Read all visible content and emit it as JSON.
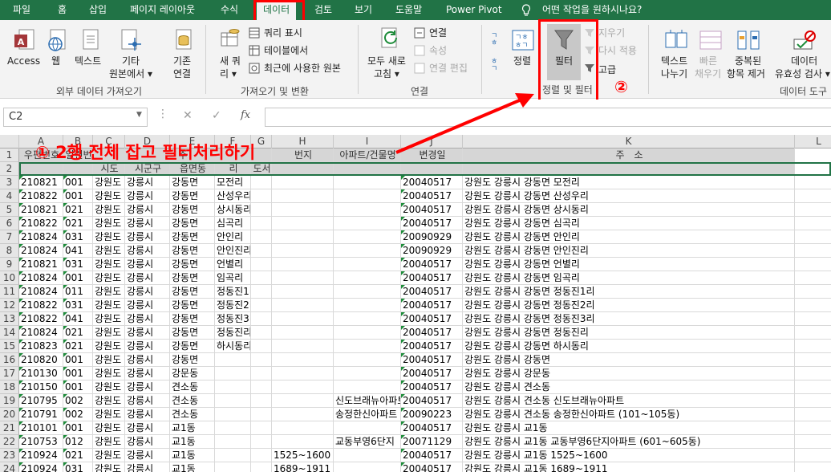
{
  "tabs": [
    "파일",
    "홈",
    "삽입",
    "페이지 레이아웃",
    "수식",
    "데이터",
    "검토",
    "보기",
    "도움말",
    "Power Pivot",
    "어떤 작업을 원하시나요?"
  ],
  "ribbon": {
    "external": {
      "access": "Access",
      "web": "웹",
      "text": "텍스트",
      "other_1": "기타",
      "other_2": "원본에서 ▾",
      "group": "외부 데이터 가져오기"
    },
    "get": {
      "existing_1": "기존",
      "existing_2": "연결",
      "newq_1": "새 쿼",
      "newq_2": "리 ▾",
      "show_query": "쿼리 표시",
      "from_table": "테이블에서",
      "recent": "최근에 사용한 원본",
      "group": "가져오기 및 변환"
    },
    "conn": {
      "refresh_1": "모두 새로",
      "refresh_2": "고침 ▾",
      "connections": "연결",
      "properties": "속성",
      "edit_links": "연결 편집",
      "group": "연결"
    },
    "sort": {
      "sort": "정렬",
      "filter": "필터",
      "clear": "지우기",
      "reapply": "다시 적용",
      "advanced": "고급",
      "group": "정렬 및 필터"
    },
    "tools": {
      "text_cols_1": "텍스트",
      "text_cols_2": "나누기",
      "flash_1": "빠른",
      "flash_2": "채우기",
      "remove_dup_1": "중복된",
      "remove_dup_2": "항목 제거",
      "validate_1": "데이터",
      "validate_2": "유효성 검사 ▾",
      "group": "데이터 도구"
    }
  },
  "formula": {
    "name_box": "C2",
    "cancel": "✕",
    "enter": "✓",
    "fx": "fx",
    "value": ""
  },
  "columns": [
    "A",
    "B",
    "C",
    "D",
    "E",
    "F",
    "G",
    "H",
    "I",
    "J",
    "K",
    "L"
  ],
  "row_numbers": [
    "1",
    "2",
    "3",
    "4",
    "5",
    "6",
    "7",
    "8",
    "9",
    "10",
    "11",
    "12",
    "13",
    "14",
    "15",
    "16",
    "17",
    "18",
    "19",
    "20",
    "21",
    "22",
    "23",
    "24"
  ],
  "header_row1": {
    "a": "우편번호",
    "b": "일련번",
    "d": "주",
    "h": "번지",
    "i": "아파트/건물명",
    "j": "변경일",
    "k": "주　소"
  },
  "header_row2": {
    "c": "시도",
    "d": "시군구",
    "e": "읍면동",
    "f": "리",
    "g": "도서"
  },
  "rows": [
    [
      "210821",
      "001",
      "강원도",
      "강릉시",
      "강동면",
      "모전리",
      "",
      "",
      "",
      "20040517",
      "강원도 강릉시 강동면 모전리"
    ],
    [
      "210822",
      "001",
      "강원도",
      "강릉시",
      "강동면",
      "산성우리",
      "",
      "",
      "",
      "20040517",
      "강원도 강릉시 강동면 산성우리"
    ],
    [
      "210821",
      "021",
      "강원도",
      "강릉시",
      "강동면",
      "상시동리",
      "",
      "",
      "",
      "20040517",
      "강원도 강릉시 강동면 상시동리"
    ],
    [
      "210822",
      "021",
      "강원도",
      "강릉시",
      "강동면",
      "심곡리",
      "",
      "",
      "",
      "20040517",
      "강원도 강릉시 강동면 심곡리"
    ],
    [
      "210824",
      "031",
      "강원도",
      "강릉시",
      "강동면",
      "안인리",
      "",
      "",
      "",
      "20090929",
      "강원도 강릉시 강동면 안인리"
    ],
    [
      "210824",
      "041",
      "강원도",
      "강릉시",
      "강동면",
      "안인진리",
      "",
      "",
      "",
      "20090929",
      "강원도 강릉시 강동면 안인진리"
    ],
    [
      "210821",
      "031",
      "강원도",
      "강릉시",
      "강동면",
      "언별리",
      "",
      "",
      "",
      "20040517",
      "강원도 강릉시 강동면 언별리"
    ],
    [
      "210824",
      "001",
      "강원도",
      "강릉시",
      "강동면",
      "임곡리",
      "",
      "",
      "",
      "20040517",
      "강원도 강릉시 강동면 임곡리"
    ],
    [
      "210824",
      "011",
      "강원도",
      "강릉시",
      "강동면",
      "정동진1리",
      "",
      "",
      "",
      "20040517",
      "강원도 강릉시 강동면 정동진1리"
    ],
    [
      "210822",
      "031",
      "강원도",
      "강릉시",
      "강동면",
      "정동진2리",
      "",
      "",
      "",
      "20040517",
      "강원도 강릉시 강동면 정동진2리"
    ],
    [
      "210822",
      "041",
      "강원도",
      "강릉시",
      "강동면",
      "정동진3리",
      "",
      "",
      "",
      "20040517",
      "강원도 강릉시 강동면 정동진3리"
    ],
    [
      "210824",
      "021",
      "강원도",
      "강릉시",
      "강동면",
      "정동진리",
      "",
      "",
      "",
      "20040517",
      "강원도 강릉시 강동면 정동진리"
    ],
    [
      "210823",
      "021",
      "강원도",
      "강릉시",
      "강동면",
      "하시동리",
      "",
      "",
      "",
      "20040517",
      "강원도 강릉시 강동면 하시동리"
    ],
    [
      "210820",
      "001",
      "강원도",
      "강릉시",
      "강동면",
      "",
      "",
      "",
      "",
      "20040517",
      "강원도 강릉시 강동면"
    ],
    [
      "210130",
      "001",
      "강원도",
      "강릉시",
      "강문동",
      "",
      "",
      "",
      "",
      "20040517",
      "강원도 강릉시 강문동"
    ],
    [
      "210150",
      "001",
      "강원도",
      "강릉시",
      "견소동",
      "",
      "",
      "",
      "",
      "20040517",
      "강원도 강릉시 견소동"
    ],
    [
      "210795",
      "002",
      "강원도",
      "강릉시",
      "견소동",
      "",
      "",
      "",
      "신도브래뉴아파트",
      "20040517",
      "강원도 강릉시 견소동 신도브래뉴아파트"
    ],
    [
      "210791",
      "002",
      "강원도",
      "강릉시",
      "견소동",
      "",
      "",
      "",
      "송정한신아파트",
      "20090223",
      "강원도 강릉시 견소동 송정한신아파트 (101~105동)"
    ],
    [
      "210101",
      "001",
      "강원도",
      "강릉시",
      "교1동",
      "",
      "",
      "",
      "",
      "20040517",
      "강원도 강릉시 교1동"
    ],
    [
      "210753",
      "012",
      "강원도",
      "강릉시",
      "교1동",
      "",
      "",
      "",
      "교동부영6단지",
      "20071129",
      "강원도 강릉시 교1동 교동부영6단지아파트 (601~605동)"
    ],
    [
      "210924",
      "021",
      "강원도",
      "강릉시",
      "교1동",
      "",
      "",
      "1525~1600",
      "",
      "20040517",
      "강원도 강릉시 교1동 1525~1600"
    ],
    [
      "210924",
      "031",
      "강원도",
      "강릉시",
      "교1동",
      "",
      "",
      "1689~1911",
      "",
      "20040517",
      "강원도 강릉시 교1동 1689~1911"
    ]
  ],
  "annotations": {
    "step1": "① 2행 전체 잡고 필터처리하기",
    "step2": "②"
  }
}
